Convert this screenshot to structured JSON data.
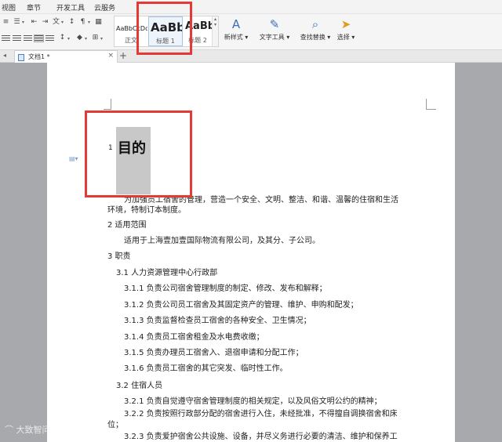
{
  "menubar": {
    "items": [
      "视图",
      "章节",
      "开发工具",
      "云服务"
    ]
  },
  "ribbon": {
    "styles": [
      {
        "preview": "AaBbCcDd",
        "caption": "正文"
      },
      {
        "preview": "AaBb",
        "caption": "标题 1"
      },
      {
        "preview": "AaBb(",
        "caption": "标题 2"
      }
    ],
    "new_style": "新样式",
    "text_tools": "文字工具",
    "find_replace": "查找替换",
    "select": "选择"
  },
  "tabbar": {
    "doc_title": "文档1 *"
  },
  "document": {
    "heading_number": "1",
    "heading_text": "目的",
    "lines": [
      "为加强员工宿舍的管理，营造一个安全、文明、整洁、和谐、温馨的住宿和生活",
      "环境，特制订本制度。",
      "2 适用范围",
      "适用于上海壹加壹国际物流有限公司，及其分、子公司。",
      "3 职责",
      "3.1  人力资源管理中心行政部",
      "3.1.1 负责公司宿舍管理制度的制定、修改、发布和解释；",
      "3.1.2 负责公司员工宿舍及其固定资产的管理、维护、申购和配发；",
      "3.1.3 负责监督检查员工宿舍的各种安全、卫生情况；",
      "3.1.4 负责员工宿舍租金及水电费收缴；",
      "3.1.5 负责办理员工宿舍入、退宿申请和分配工作；",
      "3.1.6 负责员工宿舍的其它突发、临时性工作。",
      "3.2  住宿人员",
      "3.2.1 负责自觉遵守宿舍管理制度的相关规定，以及风俗文明公约的精神；",
      "3.2.2 负责按照行政部分配的宿舍进行入住，未经批准，不得擅自调换宿舍和床",
      "位；",
      "3.2.3 负责爱护宿舍公共设施、设备，并尽义务进行必要的清洁、维护和保养工"
    ]
  },
  "watermark": "大致智问",
  "colors": {
    "annotation": "#e53935",
    "selection": "#c8c8c8"
  }
}
